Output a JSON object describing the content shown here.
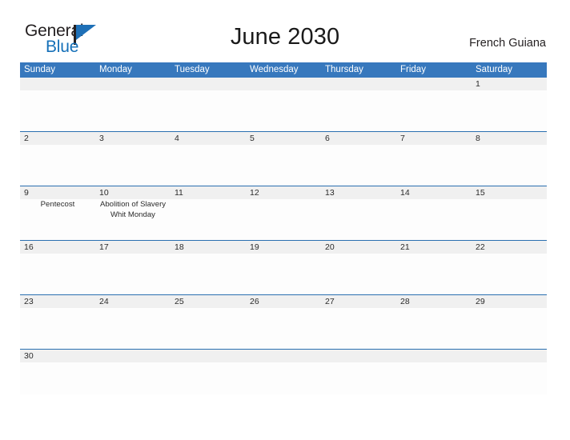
{
  "brand": {
    "name_part1": "General",
    "name_part2": "Blue",
    "flag_icon": "general-blue-flag-icon",
    "accent_color": "#1570b8"
  },
  "header": {
    "title": "June 2030",
    "locale": "French Guiana"
  },
  "theme": {
    "header_blue": "#3778bd",
    "rule_blue": "#2a6fb0",
    "daynum_band": "#f0f0f0",
    "cell_background": "#fdfdfd",
    "text_color": "#2b2b2b"
  },
  "calendar": {
    "month": "June",
    "year": "2030",
    "weekdays": [
      "Sunday",
      "Monday",
      "Tuesday",
      "Wednesday",
      "Thursday",
      "Friday",
      "Saturday"
    ],
    "weeks": [
      {
        "days": [
          {
            "num": "",
            "events": []
          },
          {
            "num": "",
            "events": []
          },
          {
            "num": "",
            "events": []
          },
          {
            "num": "",
            "events": []
          },
          {
            "num": "",
            "events": []
          },
          {
            "num": "",
            "events": []
          },
          {
            "num": "1",
            "events": []
          }
        ]
      },
      {
        "days": [
          {
            "num": "2",
            "events": []
          },
          {
            "num": "3",
            "events": []
          },
          {
            "num": "4",
            "events": []
          },
          {
            "num": "5",
            "events": []
          },
          {
            "num": "6",
            "events": []
          },
          {
            "num": "7",
            "events": []
          },
          {
            "num": "8",
            "events": []
          }
        ]
      },
      {
        "days": [
          {
            "num": "9",
            "events": [
              "Pentecost"
            ]
          },
          {
            "num": "10",
            "events": [
              "Abolition of Slavery",
              "Whit Monday"
            ]
          },
          {
            "num": "11",
            "events": []
          },
          {
            "num": "12",
            "events": []
          },
          {
            "num": "13",
            "events": []
          },
          {
            "num": "14",
            "events": []
          },
          {
            "num": "15",
            "events": []
          }
        ]
      },
      {
        "days": [
          {
            "num": "16",
            "events": []
          },
          {
            "num": "17",
            "events": []
          },
          {
            "num": "18",
            "events": []
          },
          {
            "num": "19",
            "events": []
          },
          {
            "num": "20",
            "events": []
          },
          {
            "num": "21",
            "events": []
          },
          {
            "num": "22",
            "events": []
          }
        ]
      },
      {
        "days": [
          {
            "num": "23",
            "events": []
          },
          {
            "num": "24",
            "events": []
          },
          {
            "num": "25",
            "events": []
          },
          {
            "num": "26",
            "events": []
          },
          {
            "num": "27",
            "events": []
          },
          {
            "num": "28",
            "events": []
          },
          {
            "num": "29",
            "events": []
          }
        ]
      },
      {
        "days": [
          {
            "num": "30",
            "events": []
          },
          {
            "num": "",
            "events": []
          },
          {
            "num": "",
            "events": []
          },
          {
            "num": "",
            "events": []
          },
          {
            "num": "",
            "events": []
          },
          {
            "num": "",
            "events": []
          },
          {
            "num": "",
            "events": []
          }
        ]
      }
    ]
  }
}
